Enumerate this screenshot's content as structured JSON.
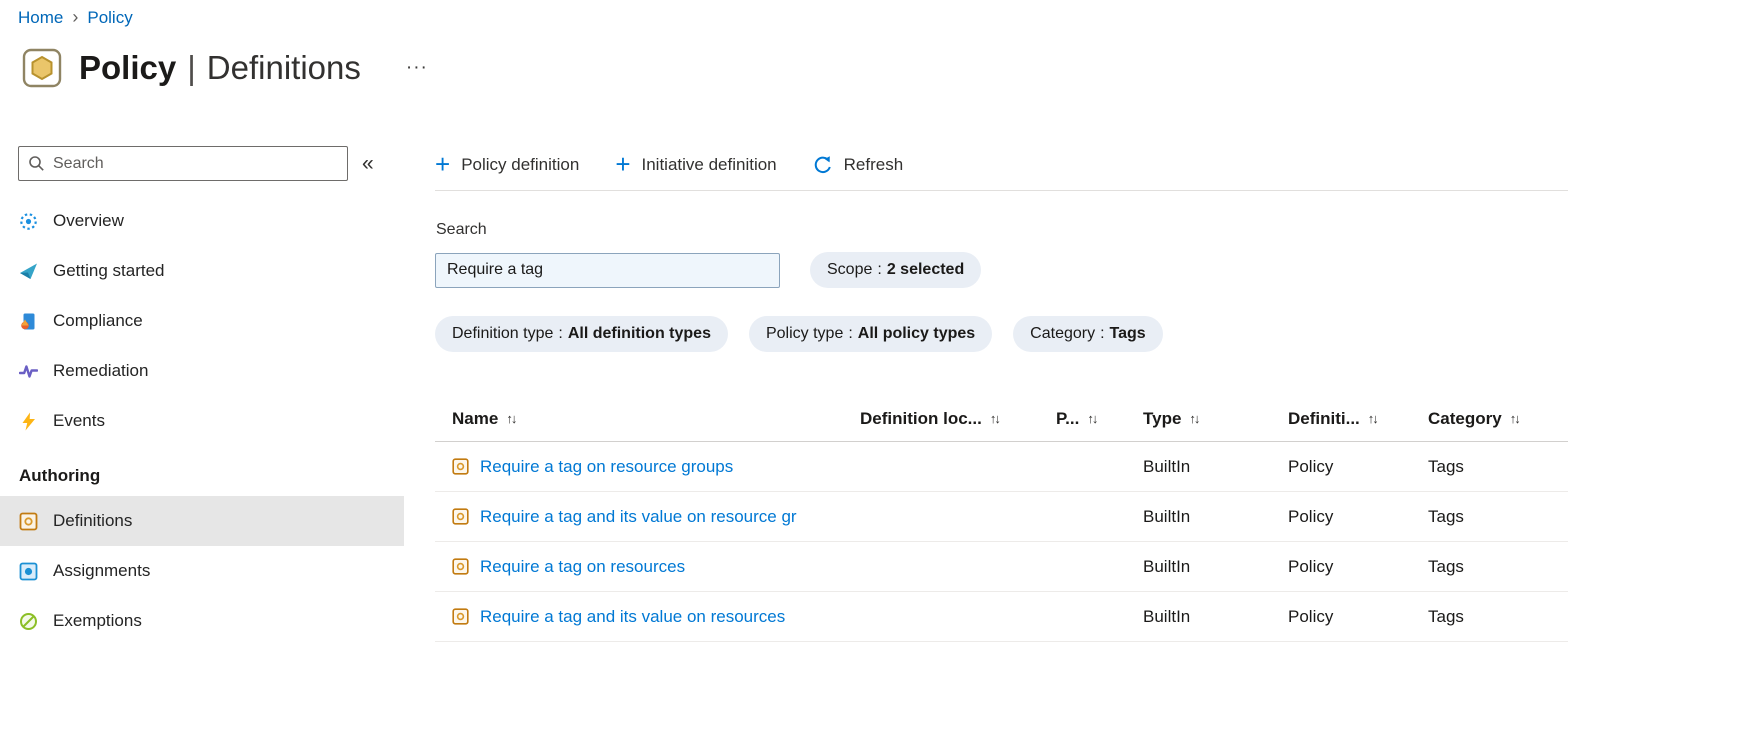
{
  "breadcrumb": {
    "items": [
      {
        "label": "Home"
      },
      {
        "label": "Policy"
      }
    ],
    "separator": "›"
  },
  "header": {
    "title_primary": "Policy",
    "title_divider": "|",
    "title_secondary": "Definitions",
    "more_glyph": "···"
  },
  "sidebar": {
    "search_placeholder": "Search",
    "collapse_glyph": "«",
    "items": [
      {
        "label": "Overview",
        "icon": "overview-icon"
      },
      {
        "label": "Getting started",
        "icon": "getting-started-icon"
      },
      {
        "label": "Compliance",
        "icon": "compliance-icon"
      },
      {
        "label": "Remediation",
        "icon": "remediation-icon"
      },
      {
        "label": "Events",
        "icon": "events-icon"
      }
    ],
    "section_label": "Authoring",
    "authoring_items": [
      {
        "label": "Definitions",
        "icon": "definitions-icon",
        "selected": true
      },
      {
        "label": "Assignments",
        "icon": "assignments-icon",
        "selected": false
      },
      {
        "label": "Exemptions",
        "icon": "exemptions-icon",
        "selected": false
      }
    ]
  },
  "toolbar": {
    "plus_glyph": "+",
    "buttons": [
      {
        "label": "Policy definition",
        "icon": "plus-icon"
      },
      {
        "label": "Initiative definition",
        "icon": "plus-icon"
      },
      {
        "label": "Refresh",
        "icon": "refresh-icon"
      }
    ]
  },
  "filters": {
    "search_label": "Search",
    "search_value": "Require a tag",
    "pill_separator": ":",
    "pills": [
      {
        "name": "Scope",
        "value": "2 selected"
      },
      {
        "name": "Definition type",
        "value": "All definition types"
      },
      {
        "name": "Policy type",
        "value": "All policy types"
      },
      {
        "name": "Category",
        "value": "Tags"
      }
    ]
  },
  "table": {
    "sort_glyph": "↑↓",
    "columns": [
      {
        "label": "Name"
      },
      {
        "label": "Definition loc..."
      },
      {
        "label": "P..."
      },
      {
        "label": "Type"
      },
      {
        "label": "Definiti..."
      },
      {
        "label": "Category"
      }
    ],
    "rows": [
      {
        "name": "Require a tag on resource groups",
        "definition_location": "",
        "policies": "",
        "type": "BuiltIn",
        "definition_type": "Policy",
        "category": "Tags"
      },
      {
        "name": "Require a tag and its value on resource gr",
        "definition_location": "",
        "policies": "",
        "type": "BuiltIn",
        "definition_type": "Policy",
        "category": "Tags"
      },
      {
        "name": "Require a tag on resources",
        "definition_location": "",
        "policies": "",
        "type": "BuiltIn",
        "definition_type": "Policy",
        "category": "Tags"
      },
      {
        "name": "Require a tag and its value on resources",
        "definition_location": "",
        "policies": "",
        "type": "BuiltIn",
        "definition_type": "Policy",
        "category": "Tags"
      }
    ]
  },
  "colors": {
    "accent": "#0078d4",
    "link": "#0078d4",
    "pill_background": "#e9eef5",
    "selected_item_background": "#e6e6e6"
  }
}
